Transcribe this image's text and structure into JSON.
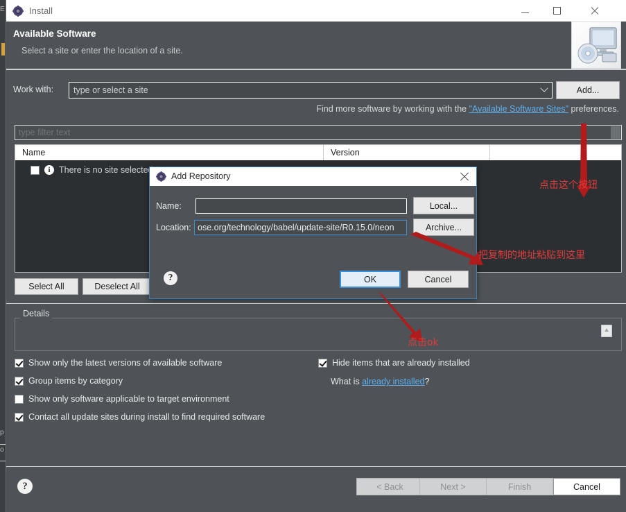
{
  "window": {
    "title": "Install",
    "icon": "eclipse-gear-icon",
    "minimize_label": "Minimize",
    "maximize_label": "Maximize",
    "close_label": "Close"
  },
  "banner": {
    "title": "Available Software",
    "subtitle": "Select a site or enter the location of a site.",
    "image": "monitor-disc-icon"
  },
  "work_with": {
    "label": "Work with:",
    "placeholder": "type or select a site",
    "value": "",
    "dropdown_icon": "chevron-down-icon",
    "add_button": "Add..."
  },
  "hint": {
    "prefix": "Find more software by working with the ",
    "link": "\"Available Software Sites\"",
    "suffix": " preferences."
  },
  "filter": {
    "placeholder": "type filter text",
    "value": ""
  },
  "table": {
    "columns": [
      "Name",
      "Version"
    ],
    "empty_row": {
      "checkbox_checked": false,
      "icon": "info-icon",
      "text": "There is no site selected."
    }
  },
  "selection_buttons": {
    "select_all": "Select All",
    "deselect_all": "Deselect All"
  },
  "details": {
    "legend": "Details",
    "content": "",
    "corner_icon": "expand-icon"
  },
  "options": {
    "left": [
      {
        "label": "Show only the latest versions of available software",
        "checked": true
      },
      {
        "label": "Group items by category",
        "checked": true
      },
      {
        "label": "Show only software applicable to target environment",
        "checked": false
      },
      {
        "label": "Contact all update sites during install to find required software",
        "checked": true
      }
    ],
    "right": [
      {
        "label": "Hide items that are already installed",
        "checked": true
      }
    ],
    "what_is": {
      "prefix": "What is ",
      "link": "already installed",
      "suffix": "?"
    }
  },
  "wizard_buttons": {
    "help_icon": "question-mark-icon",
    "back": "< Back",
    "next": "Next >",
    "finish": "Finish",
    "cancel": "Cancel"
  },
  "modal": {
    "title": "Add Repository",
    "icon": "eclipse-gear-icon",
    "close_icon": "close-icon",
    "name_label": "Name:",
    "name_value": "",
    "location_label": "Location:",
    "location_value": "ose.org/technology/babel/update-site/R0.15.0/neon",
    "local_button": "Local...",
    "archive_button": "Archive...",
    "help_icon": "question-mark-icon",
    "ok_button": "OK",
    "cancel_button": "Cancel"
  },
  "annotations": [
    {
      "text": "点击这个按钮",
      "meaning": "click this button"
    },
    {
      "text": "把复制的地址粘贴到这里",
      "meaning": "paste the copied address here"
    },
    {
      "text": "点击ok",
      "meaning": "click ok"
    }
  ],
  "background": {
    "fragment_1": "E",
    "fragment_2": "p",
    "fragment_3": "o"
  },
  "colors": {
    "window_bg": "#4f5357",
    "titlebar": "#ffffff",
    "accent_blue": "#3a8fd9",
    "link": "#5db0f0",
    "annotation_red": "#e23b3b",
    "table_bg": "#2c2f31"
  }
}
